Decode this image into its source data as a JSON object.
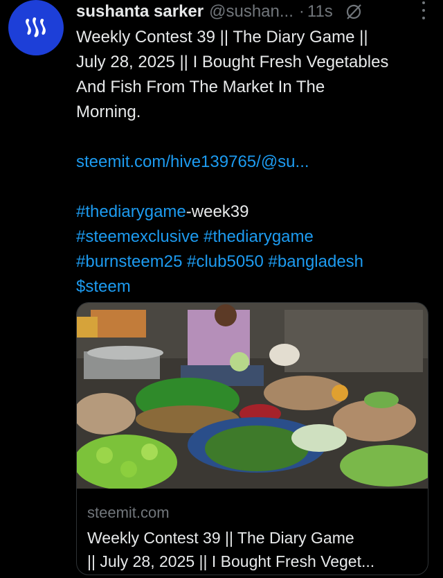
{
  "author": {
    "name": "sushanta sarker",
    "handle": "@sushan...",
    "separator": "·",
    "time": "11s"
  },
  "tweet": {
    "title_lines": [
      "Weekly Contest 39 || The Diary Game ||",
      "July 28, 2025 || I Bought Fresh Vegetables",
      "And Fish From The Market In The",
      "Morning."
    ],
    "link": "steemit.com/hive139765/@su...",
    "hashtag1": "#thediarygame",
    "hashtag1_suffix": "-week39",
    "hashtag2": "#steemexclusive",
    "hashtag3": "#thediarygame",
    "hashtag4": "#burnsteem25",
    "hashtag5": "#club5050",
    "hashtag6": "#bangladesh",
    "cashtag": "$steem"
  },
  "card": {
    "domain": "steemit.com",
    "title_lines": [
      "Weekly Contest 39 || The Diary Game",
      "|| July 28, 2025 || I Bought Fresh Veget..."
    ]
  },
  "icons": {
    "avatar": "steem-logo-icon",
    "grok": "grok-slash-icon",
    "more": "more-vertical-icon"
  },
  "colors": {
    "background": "#000000",
    "text": "#e7e9ea",
    "muted": "#71767b",
    "link": "#1d9bf0",
    "avatar": "#1d3fd8"
  }
}
